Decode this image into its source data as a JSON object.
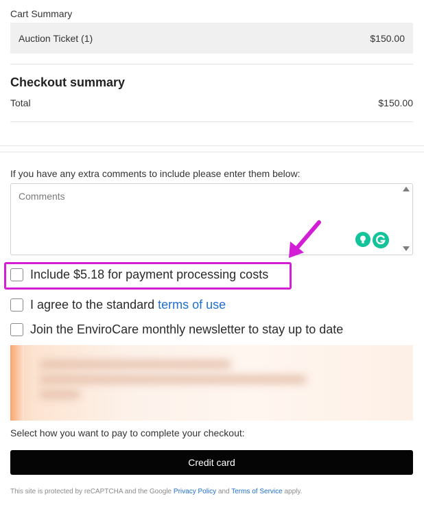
{
  "cart": {
    "title": "Cart Summary",
    "item_label": "Auction Ticket (1)",
    "item_price": "$150.00"
  },
  "checkout": {
    "title": "Checkout summary",
    "total_label": "Total",
    "total_value": "$150.00"
  },
  "comments": {
    "label": "If you have any extra comments to include please enter them below:",
    "placeholder": "Comments"
  },
  "options": {
    "processing_fee": "Include $5.18 for payment processing costs",
    "agree_prefix": "I agree to the standard",
    "terms_link": "terms of use",
    "newsletter": "Join the EnviroCare monthly newsletter to stay up to date"
  },
  "payment": {
    "label": "Select how you want to pay to complete your checkout:",
    "credit_card_button": "Credit card"
  },
  "footer": {
    "prefix": "This site is protected by reCAPTCHA and the Google",
    "privacy_link": "Privacy Policy",
    "and": "and",
    "terms_link": "Terms of Service",
    "suffix": "apply."
  },
  "colors": {
    "highlight": "#d21ed4",
    "link": "#1f6fd0",
    "button_bg": "#050505",
    "grammarly": "#15c39a"
  },
  "icons": {
    "annotation": "magenta-arrow-icon",
    "grammarly_bulb": "lightbulb-icon",
    "grammarly_logo": "grammarly-icon",
    "scroll_up": "scroll-up-arrow-icon",
    "scroll_down": "scroll-down-arrow-icon"
  }
}
